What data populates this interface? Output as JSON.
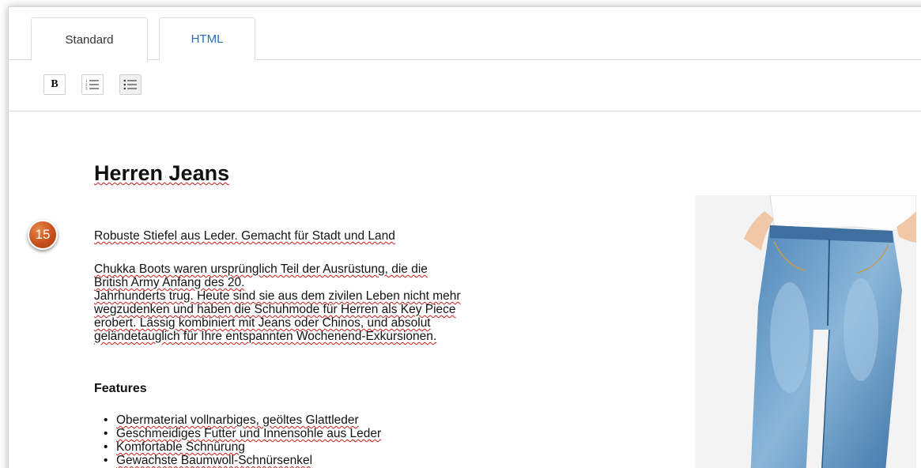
{
  "tabs": [
    {
      "label": "Standard",
      "active": true
    },
    {
      "label": "HTML",
      "active": false
    }
  ],
  "toolbar": {
    "bold_label": "B",
    "ordered_list_icon": "ordered-list-icon",
    "unordered_list_icon": "unordered-list-icon"
  },
  "content": {
    "heading": "Herren Jeans",
    "subtitle": "Robuste Stiefel aus Leder. Gemacht für Stadt und Land",
    "paragraph_lines": [
      "Chukka Boots waren ursprünglich Teil der Ausrüstung, die die",
      "British Army Anfang des 20.",
      "Jahrhunderts trug. Heute sind sie aus dem zivilen Leben nicht mehr",
      "wegzudenken und haben die Schuhmode für Herren als Key Piece",
      "erobert.  Lässig kombiniert mit Jeans oder Chinos, und absolut",
      "geländetauglich für Ihre entspannten Wochenend-Exkursionen."
    ],
    "features_heading": "Features",
    "features": [
      "Obermaterial vollnarbiges, geöltes Glattleder",
      "Geschmeidiges Futter und Innensohle aus Leder",
      "Komfortable Schnürung",
      "Gewachste Baumwoll-Schnürsenkel"
    ]
  },
  "badge": {
    "number": "15",
    "color": "#c7501b"
  },
  "colors": {
    "tab_link": "#2a6db5",
    "spellcheck": "#d01a1a",
    "jeans": "#6a9cc7"
  }
}
